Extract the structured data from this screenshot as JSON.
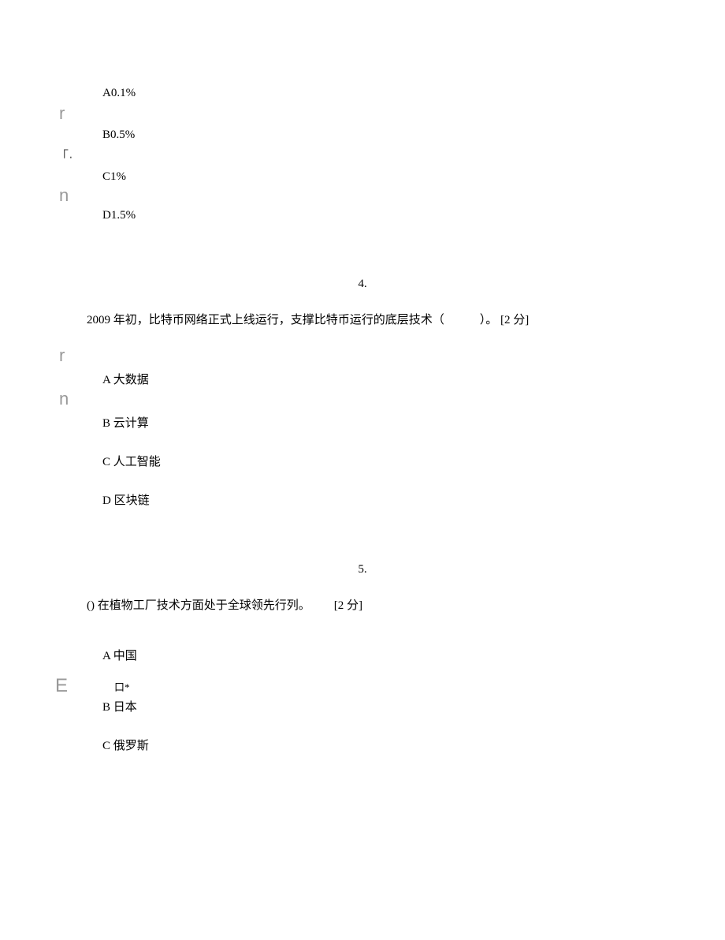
{
  "q3": {
    "options": {
      "a": "A0.1%",
      "b": "B0.5%",
      "c": "C1%",
      "d": "D1.5%"
    },
    "markers": {
      "r": "r",
      "bracket": "「·",
      "n": "n"
    }
  },
  "q4": {
    "number": "4.",
    "text": "2009 年初，比特币网络正式上线运行，支撑比特币运行的底层技术（   ）。 [2 分]",
    "options": {
      "a": "A 大数据",
      "b": "B 云计算",
      "c": "C 人工智能",
      "d": "D 区块链"
    },
    "markers": {
      "r": "r",
      "n": "n"
    }
  },
  "q5": {
    "number": "5.",
    "text": "() 在植物工厂技术方面处于全球领先行列。  [2 分]",
    "options": {
      "a": "A 中国",
      "b": "B 日本",
      "c": "C 俄罗斯"
    },
    "markers": {
      "e": "E",
      "box": "口*"
    }
  }
}
